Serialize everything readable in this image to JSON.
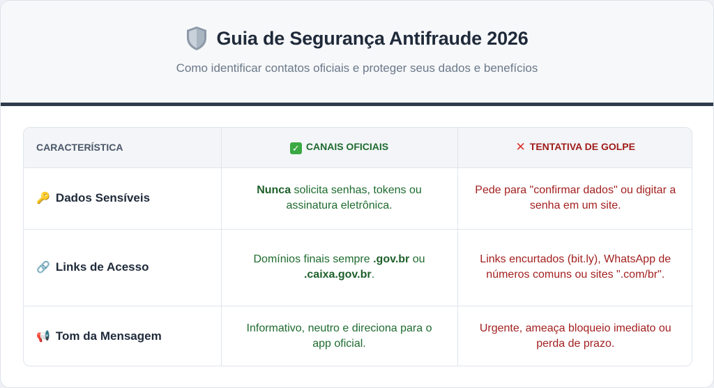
{
  "header": {
    "icon": "shield-icon",
    "title": "Guia de Segurança Antifraude 2026",
    "subtitle": "Como identificar contatos oficiais e proteger seus dados e benefícios"
  },
  "table": {
    "columns": {
      "feature": "CARACTERÍSTICA",
      "official": "CANAIS OFICIAIS",
      "scam": "TENTATIVA DE GOLPE"
    },
    "rows": [
      {
        "icon": "🔑",
        "feature": "Dados Sensíveis",
        "official_bold": "Nunca",
        "official_rest": " solicita senhas, tokens ou assinatura eletrônica.",
        "scam": "Pede para \"confirmar dados\" ou digitar a senha em um site."
      },
      {
        "icon": "🔗",
        "feature": "Links de Acesso",
        "official_pre": "Domínios finais sempre ",
        "official_bold1": ".gov.br",
        "official_mid": " ou ",
        "official_bold2": ".caixa.gov.br",
        "official_post": ".",
        "scam": "Links encurtados (bit.ly), WhatsApp de números comuns ou sites \".com/br\"."
      },
      {
        "icon": "📢",
        "feature": "Tom da Mensagem",
        "official": "Informativo, neutro e direciona para o app oficial.",
        "scam": "Urgente, ameaça bloqueio imediato ou perda de prazo."
      }
    ]
  },
  "colors": {
    "official": "#1e6b2f",
    "scam": "#a31f1f",
    "rule": "#2f3b4d"
  }
}
